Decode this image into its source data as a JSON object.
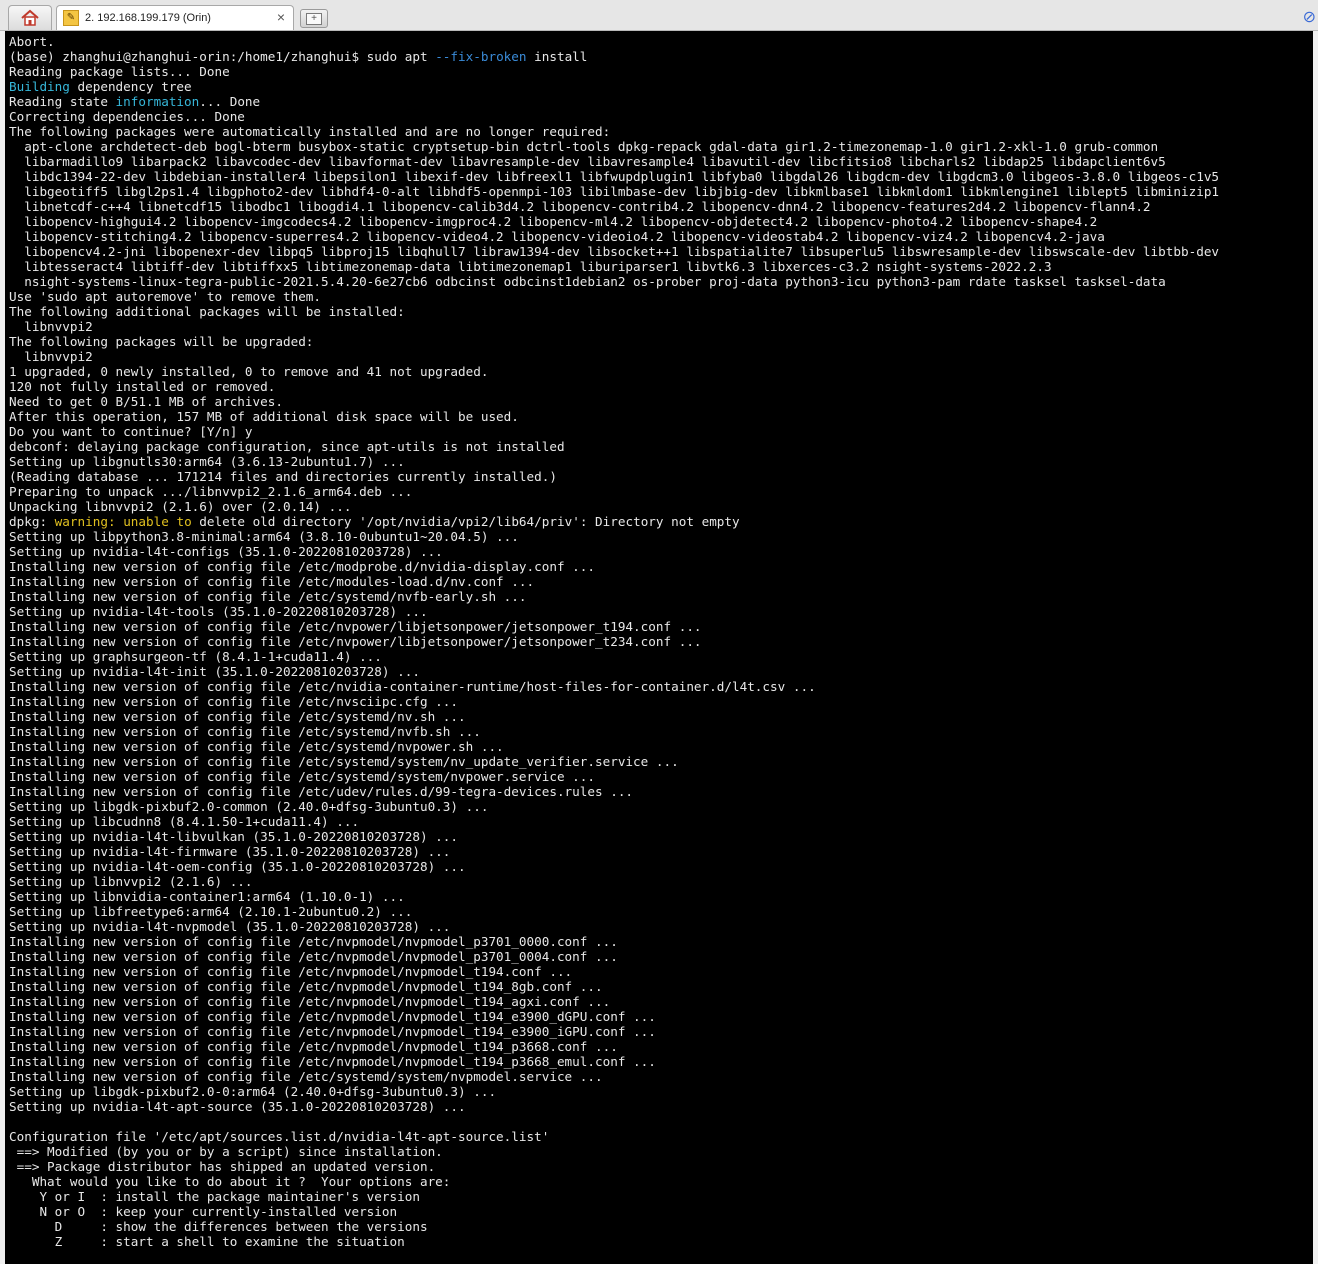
{
  "window": {
    "home_icon": "home-icon",
    "tab_title": "2. 192.168.199.179 (Orin)",
    "tab_icon": "wrench-icon",
    "tab_close": "×",
    "new_tab_icon": "plus-icon",
    "attach_icon": "paperclip-icon"
  },
  "colors": {
    "terminal_bg": "#000000",
    "terminal_fg": "#e8e8e8",
    "highlight_cyan": "#36b6d8",
    "highlight_yellow": "#e0c020",
    "highlight_blue": "#3a8bd8"
  },
  "terminal": {
    "lines": [
      "Abort.",
      "(base) zhanghui@zhanghui-orin:/home1/zhanghui$ sudo apt --fix-broken install",
      "Reading package lists... Done",
      "Building dependency tree",
      "Reading state information... Done",
      "Correcting dependencies... Done",
      "The following packages were automatically installed and are no longer required:",
      "  apt-clone archdetect-deb bogl-bterm busybox-static cryptsetup-bin dctrl-tools dpkg-repack gdal-data gir1.2-timezonemap-1.0 gir1.2-xkl-1.0 grub-common",
      "  libarmadillo9 libarpack2 libavcodec-dev libavformat-dev libavresample-dev libavresample4 libavutil-dev libcfitsio8 libcharls2 libdap25 libdapclient6v5",
      "  libdc1394-22-dev libdebian-installer4 libepsilon1 libexif-dev libfreexl1 libfwupdplugin1 libfyba0 libgdal26 libgdcm-dev libgdcm3.0 libgeos-3.8.0 libgeos-c1v5",
      "  libgeotiff5 libgl2ps1.4 libgphoto2-dev libhdf4-0-alt libhdf5-openmpi-103 libilmbase-dev libjbig-dev libkmlbase1 libkmldom1 libkmlengine1 liblept5 libminizip1",
      "  libnetcdf-c++4 libnetcdf15 libodbc1 libogdi4.1 libopencv-calib3d4.2 libopencv-contrib4.2 libopencv-dnn4.2 libopencv-features2d4.2 libopencv-flann4.2",
      "  libopencv-highgui4.2 libopencv-imgcodecs4.2 libopencv-imgproc4.2 libopencv-ml4.2 libopencv-objdetect4.2 libopencv-photo4.2 libopencv-shape4.2",
      "  libopencv-stitching4.2 libopencv-superres4.2 libopencv-video4.2 libopencv-videoio4.2 libopencv-videostab4.2 libopencv-viz4.2 libopencv4.2-java",
      "  libopencv4.2-jni libopenexr-dev libpq5 libproj15 libqhull7 libraw1394-dev libsocket++1 libspatialite7 libsuperlu5 libswresample-dev libswscale-dev libtbb-dev",
      "  libtesseract4 libtiff-dev libtiffxx5 libtimezonemap-data libtimezonemap1 liburiparser1 libvtk6.3 libxerces-c3.2 nsight-systems-2022.2.3",
      "  nsight-systems-linux-tegra-public-2021.5.4.20-6e27cb6 odbcinst odbcinst1debian2 os-prober proj-data python3-icu python3-pam rdate tasksel tasksel-data",
      "Use 'sudo apt autoremove' to remove them.",
      "The following additional packages will be installed:",
      "  libnvvpi2",
      "The following packages will be upgraded:",
      "  libnvvpi2",
      "1 upgraded, 0 newly installed, 0 to remove and 41 not upgraded.",
      "120 not fully installed or removed.",
      "Need to get 0 B/51.1 MB of archives.",
      "After this operation, 157 MB of additional disk space will be used.",
      "Do you want to continue? [Y/n] y",
      "debconf: delaying package configuration, since apt-utils is not installed",
      "Setting up libgnutls30:arm64 (3.6.13-2ubuntu1.7) ...",
      "(Reading database ... 171214 files and directories currently installed.)",
      "Preparing to unpack .../libnvvpi2_2.1.6_arm64.deb ...",
      "Unpacking libnvvpi2 (2.1.6) over (2.0.14) ...",
      "dpkg: warning: unable to delete old directory '/opt/nvidia/vpi2/lib64/priv': Directory not empty",
      "Setting up libpython3.8-minimal:arm64 (3.8.10-0ubuntu1~20.04.5) ...",
      "Setting up nvidia-l4t-configs (35.1.0-20220810203728) ...",
      "Installing new version of config file /etc/modprobe.d/nvidia-display.conf ...",
      "Installing new version of config file /etc/modules-load.d/nv.conf ...",
      "Installing new version of config file /etc/systemd/nvfb-early.sh ...",
      "Setting up nvidia-l4t-tools (35.1.0-20220810203728) ...",
      "Installing new version of config file /etc/nvpower/libjetsonpower/jetsonpower_t194.conf ...",
      "Installing new version of config file /etc/nvpower/libjetsonpower/jetsonpower_t234.conf ...",
      "Setting up graphsurgeon-tf (8.4.1-1+cuda11.4) ...",
      "Setting up nvidia-l4t-init (35.1.0-20220810203728) ...",
      "Installing new version of config file /etc/nvidia-container-runtime/host-files-for-container.d/l4t.csv ...",
      "Installing new version of config file /etc/nvsciipc.cfg ...",
      "Installing new version of config file /etc/systemd/nv.sh ...",
      "Installing new version of config file /etc/systemd/nvfb.sh ...",
      "Installing new version of config file /etc/systemd/nvpower.sh ...",
      "Installing new version of config file /etc/systemd/system/nv_update_verifier.service ...",
      "Installing new version of config file /etc/systemd/system/nvpower.service ...",
      "Installing new version of config file /etc/udev/rules.d/99-tegra-devices.rules ...",
      "Setting up libgdk-pixbuf2.0-common (2.40.0+dfsg-3ubuntu0.3) ...",
      "Setting up libcudnn8 (8.4.1.50-1+cuda11.4) ...",
      "Setting up nvidia-l4t-libvulkan (35.1.0-20220810203728) ...",
      "Setting up nvidia-l4t-firmware (35.1.0-20220810203728) ...",
      "Setting up nvidia-l4t-oem-config (35.1.0-20220810203728) ...",
      "Setting up libnvvpi2 (2.1.6) ...",
      "Setting up libnvidia-container1:arm64 (1.10.0-1) ...",
      "Setting up libfreetype6:arm64 (2.10.1-2ubuntu0.2) ...",
      "Setting up nvidia-l4t-nvpmodel (35.1.0-20220810203728) ...",
      "Installing new version of config file /etc/nvpmodel/nvpmodel_p3701_0000.conf ...",
      "Installing new version of config file /etc/nvpmodel/nvpmodel_p3701_0004.conf ...",
      "Installing new version of config file /etc/nvpmodel/nvpmodel_t194.conf ...",
      "Installing new version of config file /etc/nvpmodel/nvpmodel_t194_8gb.conf ...",
      "Installing new version of config file /etc/nvpmodel/nvpmodel_t194_agxi.conf ...",
      "Installing new version of config file /etc/nvpmodel/nvpmodel_t194_e3900_dGPU.conf ...",
      "Installing new version of config file /etc/nvpmodel/nvpmodel_t194_e3900_iGPU.conf ...",
      "Installing new version of config file /etc/nvpmodel/nvpmodel_t194_p3668.conf ...",
      "Installing new version of config file /etc/nvpmodel/nvpmodel_t194_p3668_emul.conf ...",
      "Installing new version of config file /etc/systemd/system/nvpmodel.service ...",
      "Setting up libgdk-pixbuf2.0-0:arm64 (2.40.0+dfsg-3ubuntu0.3) ...",
      "Setting up nvidia-l4t-apt-source (35.1.0-20220810203728) ...",
      "",
      "Configuration file '/etc/apt/sources.list.d/nvidia-l4t-apt-source.list'",
      " ==> Modified (by you or by a script) since installation.",
      " ==> Package distributor has shipped an updated version.",
      "   What would you like to do about it ?  Your options are:",
      "    Y or I  : install the package maintainer's version",
      "    N or O  : keep your currently-installed version",
      "      D     : show the differences between the versions",
      "      Z     : start a shell to examine the situation"
    ],
    "highlights": [
      {
        "line": 1,
        "text": "--fix-broken",
        "color": "#3a8bd8"
      },
      {
        "line": 3,
        "text": "Building",
        "color": "#36b6d8"
      },
      {
        "line": 4,
        "text": "information",
        "color": "#36b6d8"
      },
      {
        "line": 32,
        "text": "warning:",
        "color": "#e0c020"
      },
      {
        "line": 32,
        "text": "unable to",
        "color": "#e0c020"
      }
    ]
  }
}
